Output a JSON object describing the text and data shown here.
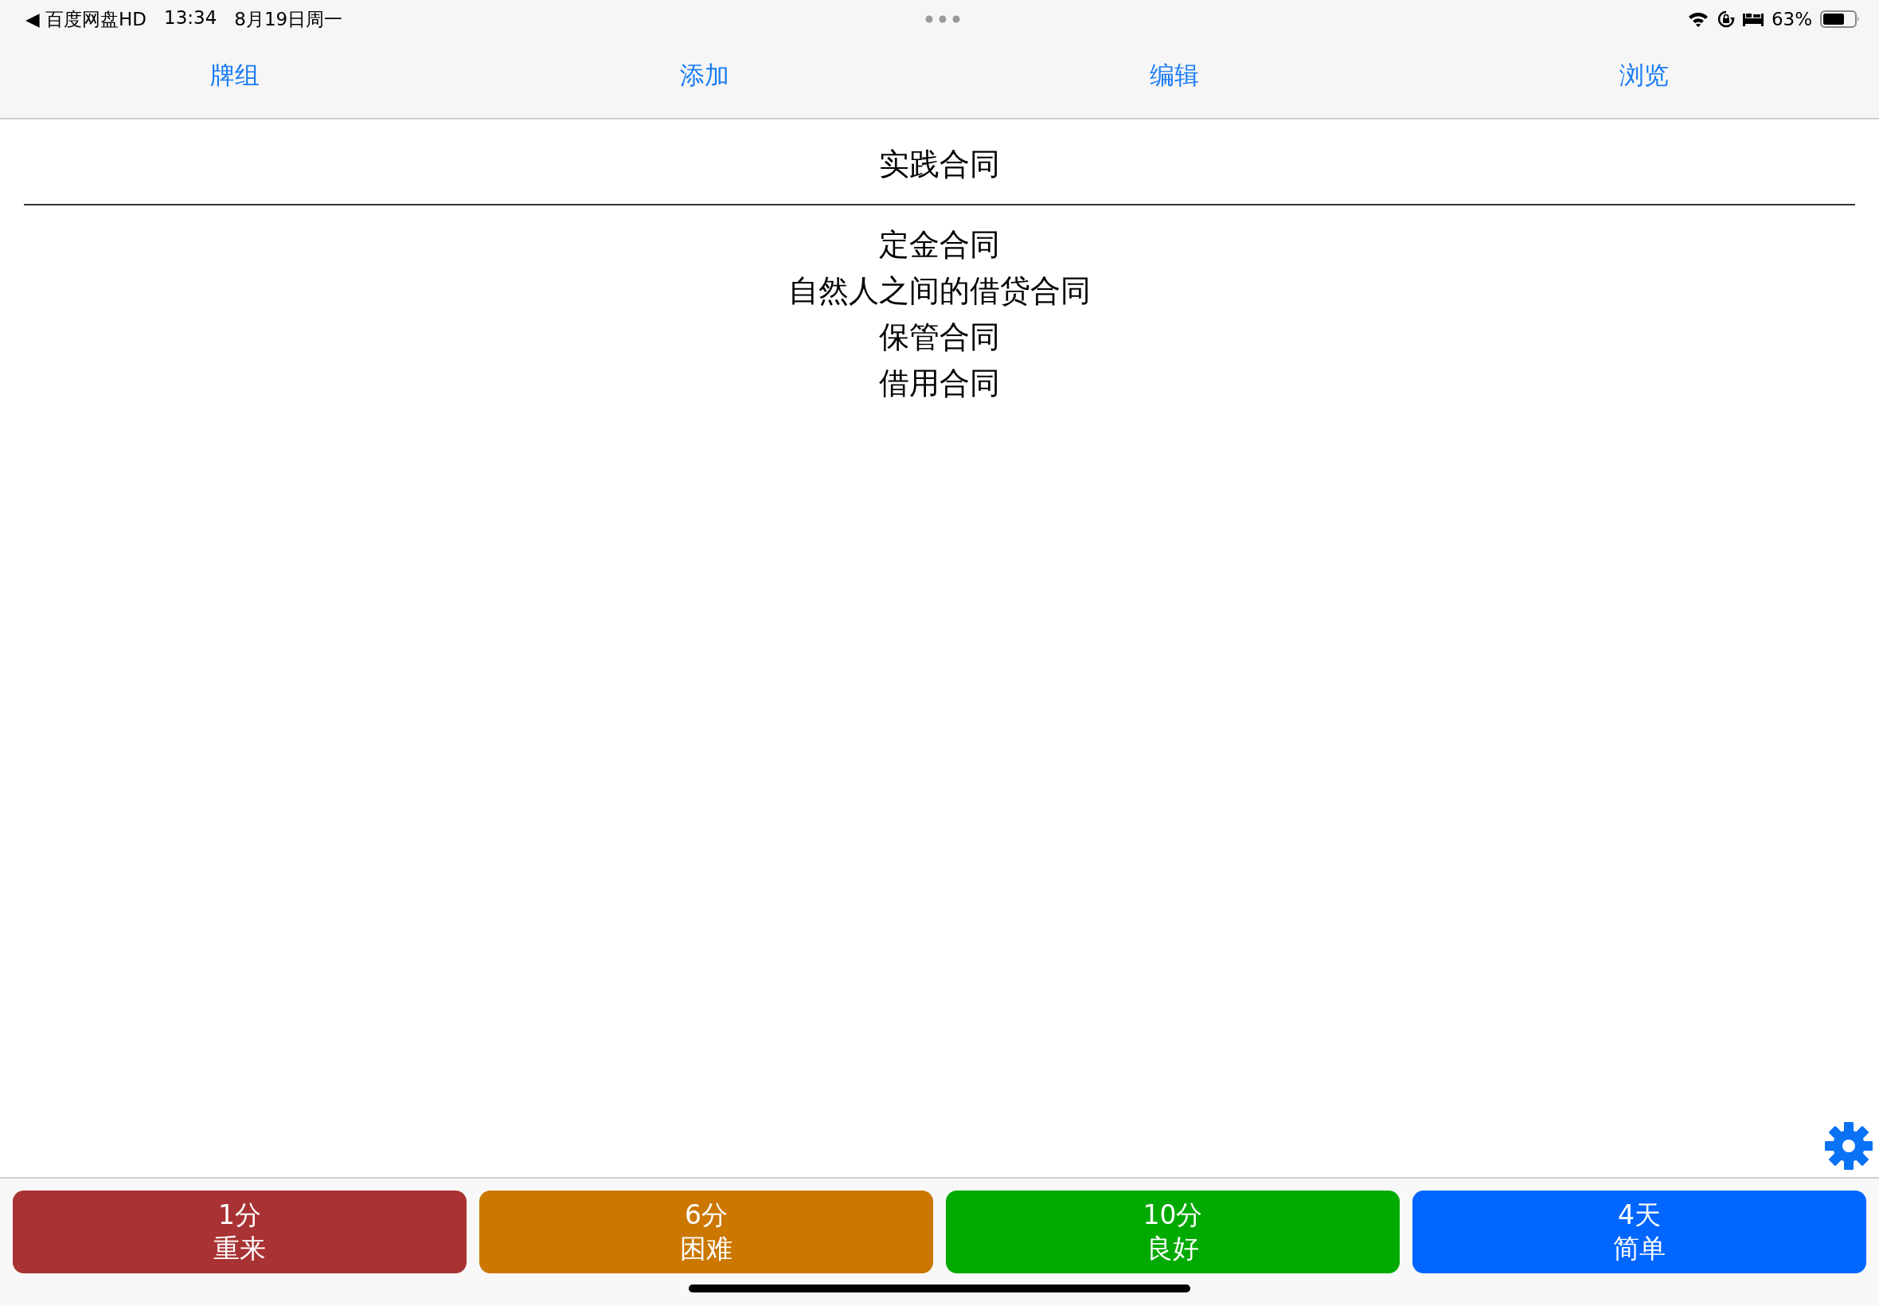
{
  "status_bar": {
    "back_app": "◀ 百度网盘HD",
    "time": "13:34",
    "date": "8月19日周一",
    "battery": "63%"
  },
  "tabs": [
    {
      "label": "牌组"
    },
    {
      "label": "添加"
    },
    {
      "label": "编辑"
    },
    {
      "label": "浏览"
    }
  ],
  "card": {
    "question": "实践合同",
    "answers": [
      "定金合同",
      "自然人之间的借贷合同",
      "保管合同",
      "借用合同"
    ]
  },
  "answer_buttons": [
    {
      "interval": "1分",
      "label": "重来",
      "color": "#a93234"
    },
    {
      "interval": "6分",
      "label": "困难",
      "color": "#cb7700"
    },
    {
      "interval": "10分",
      "label": "良好",
      "color": "#00aa00"
    },
    {
      "interval": "4天",
      "label": "简单",
      "color": "#0066ff"
    }
  ]
}
